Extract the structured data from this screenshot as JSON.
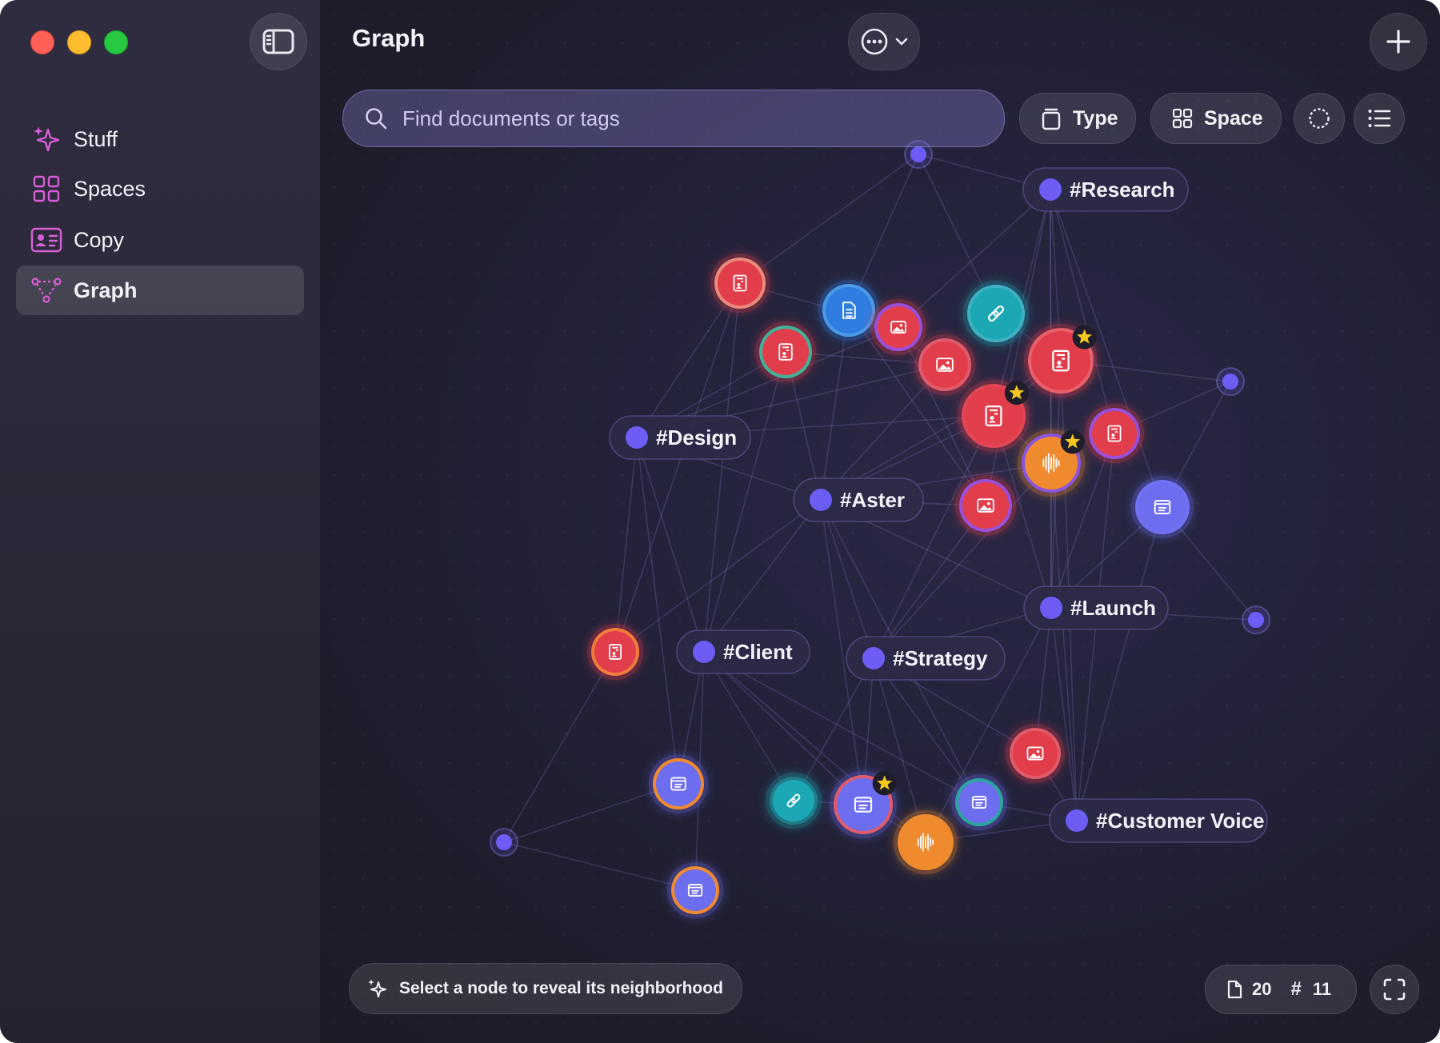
{
  "window": {
    "title": "Graph",
    "controls": [
      "close",
      "minimize",
      "zoom"
    ]
  },
  "sidebar": {
    "toggle_icon": "sidebar-toggle-icon",
    "items": [
      {
        "label": "Stuff",
        "icon": "sparkles-icon",
        "active": false
      },
      {
        "label": "Spaces",
        "icon": "grid-icon",
        "active": false
      },
      {
        "label": "Copy",
        "icon": "contact-card-icon",
        "active": false
      },
      {
        "label": "Graph",
        "icon": "graph-icon",
        "active": true
      }
    ]
  },
  "toolbar": {
    "more_icon": "ellipsis-circle-icon",
    "add_icon": "plus-icon"
  },
  "search": {
    "placeholder": "Find documents or tags",
    "value": ""
  },
  "filters": {
    "type_label": "Type",
    "space_label": "Space",
    "circle_icon": "dashed-circle-icon",
    "list_icon": "list-icon"
  },
  "graph": {
    "tags": [
      {
        "label": "#Research"
      },
      {
        "label": "#Design"
      },
      {
        "label": "#Aster"
      },
      {
        "label": "#Launch"
      },
      {
        "label": "#Client"
      },
      {
        "label": "#Strategy"
      },
      {
        "label": "#Customer Voice"
      }
    ],
    "node_kinds": {
      "contact": "contact-card-icon",
      "document": "document-icon",
      "image": "image-icon",
      "link": "link-icon",
      "audio": "waveform-icon",
      "note": "note-icon"
    },
    "colors": {
      "contact": "#e23d4b",
      "image": "#e23d4b",
      "document": "#2f7de0",
      "link": "#1ba7b4",
      "audio": "#f08a2e",
      "note": "#6d6df0",
      "tag_dot": "#6d5df5",
      "star": "#f8c91c"
    }
  },
  "footer": {
    "hint": "Select a node to reveal its neighborhood",
    "doc_count": "20",
    "hash_symbol": "#",
    "tag_count": "11",
    "fullscreen_icon": "fullscreen-icon"
  }
}
